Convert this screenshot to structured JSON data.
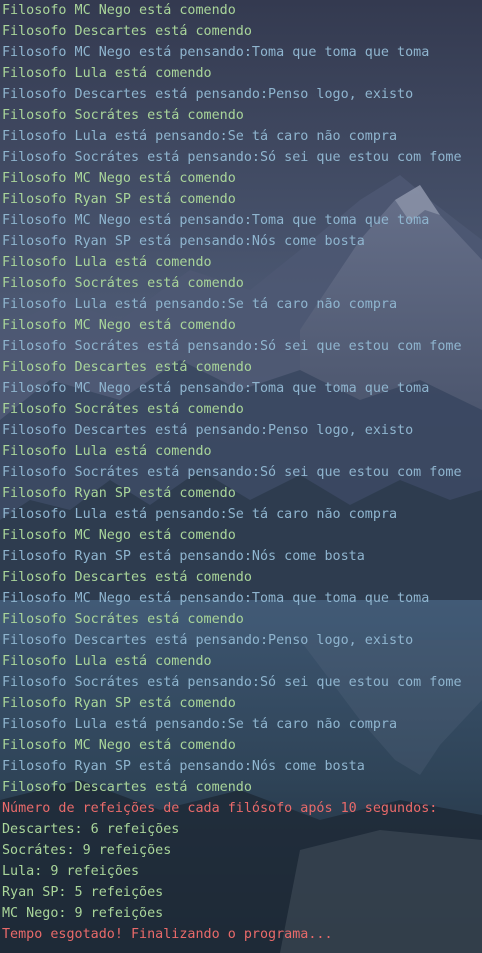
{
  "colors": {
    "eating": "#a9d59a",
    "thinking": "#8fb5cf",
    "alert": "#e96a6a"
  },
  "wallpaper_icon": "mountain-lake-landscape",
  "terminal": {
    "lines": [
      {
        "text": "Filosofo MC Nego está comendo",
        "kind": "eating"
      },
      {
        "text": "Filosofo Descartes está comendo",
        "kind": "eating"
      },
      {
        "text": "Filosofo MC Nego está pensando:Toma que toma que toma",
        "kind": "thinking"
      },
      {
        "text": "Filosofo Lula está comendo",
        "kind": "eating"
      },
      {
        "text": "Filosofo Descartes está pensando:Penso logo, existo",
        "kind": "thinking"
      },
      {
        "text": "Filosofo Socrátes está comendo",
        "kind": "eating"
      },
      {
        "text": "Filosofo Lula está pensando:Se tá caro não compra",
        "kind": "thinking"
      },
      {
        "text": "Filosofo Socrátes está pensando:Só sei que estou com fome",
        "kind": "thinking"
      },
      {
        "text": "Filosofo MC Nego está comendo",
        "kind": "eating"
      },
      {
        "text": "Filosofo Ryan SP está comendo",
        "kind": "eating"
      },
      {
        "text": "Filosofo MC Nego está pensando:Toma que toma que toma",
        "kind": "thinking"
      },
      {
        "text": "Filosofo Ryan SP está pensando:Nós come bosta",
        "kind": "thinking"
      },
      {
        "text": "Filosofo Lula está comendo",
        "kind": "eating"
      },
      {
        "text": "Filosofo Socrátes está comendo",
        "kind": "eating"
      },
      {
        "text": "Filosofo Lula está pensando:Se tá caro não compra",
        "kind": "thinking"
      },
      {
        "text": "Filosofo MC Nego está comendo",
        "kind": "eating"
      },
      {
        "text": "Filosofo Socrátes está pensando:Só sei que estou com fome",
        "kind": "thinking"
      },
      {
        "text": "Filosofo Descartes está comendo",
        "kind": "eating"
      },
      {
        "text": "Filosofo MC Nego está pensando:Toma que toma que toma",
        "kind": "thinking"
      },
      {
        "text": "Filosofo Socrátes está comendo",
        "kind": "eating"
      },
      {
        "text": "Filosofo Descartes está pensando:Penso logo, existo",
        "kind": "thinking"
      },
      {
        "text": "Filosofo Lula está comendo",
        "kind": "eating"
      },
      {
        "text": "Filosofo Socrátes está pensando:Só sei que estou com fome",
        "kind": "thinking"
      },
      {
        "text": "Filosofo Ryan SP está comendo",
        "kind": "eating"
      },
      {
        "text": "Filosofo Lula está pensando:Se tá caro não compra",
        "kind": "thinking"
      },
      {
        "text": "Filosofo MC Nego está comendo",
        "kind": "eating"
      },
      {
        "text": "Filosofo Ryan SP está pensando:Nós come bosta",
        "kind": "thinking"
      },
      {
        "text": "Filosofo Descartes está comendo",
        "kind": "eating"
      },
      {
        "text": "Filosofo MC Nego está pensando:Toma que toma que toma",
        "kind": "thinking"
      },
      {
        "text": "Filosofo Socrátes está comendo",
        "kind": "eating"
      },
      {
        "text": "Filosofo Descartes está pensando:Penso logo, existo",
        "kind": "thinking"
      },
      {
        "text": "Filosofo Lula está comendo",
        "kind": "eating"
      },
      {
        "text": "Filosofo Socrátes está pensando:Só sei que estou com fome",
        "kind": "thinking"
      },
      {
        "text": "Filosofo Ryan SP está comendo",
        "kind": "eating"
      },
      {
        "text": "Filosofo Lula está pensando:Se tá caro não compra",
        "kind": "thinking"
      },
      {
        "text": "Filosofo MC Nego está comendo",
        "kind": "eating"
      },
      {
        "text": "Filosofo Ryan SP está pensando:Nós come bosta",
        "kind": "thinking"
      },
      {
        "text": "Filosofo Descartes está comendo",
        "kind": "eating"
      },
      {
        "text": "Número de refeições de cada filósofo após 10 segundos:",
        "kind": "alert"
      },
      {
        "text": "Descartes: 6 refeições",
        "kind": "eating"
      },
      {
        "text": "Socrátes: 9 refeições",
        "kind": "eating"
      },
      {
        "text": "Lula: 9 refeições",
        "kind": "eating"
      },
      {
        "text": "Ryan SP: 5 refeições",
        "kind": "eating"
      },
      {
        "text": "MC Nego: 9 refeições",
        "kind": "eating"
      },
      {
        "text": "Tempo esgotado! Finalizando o programa...",
        "kind": "alert"
      }
    ]
  }
}
